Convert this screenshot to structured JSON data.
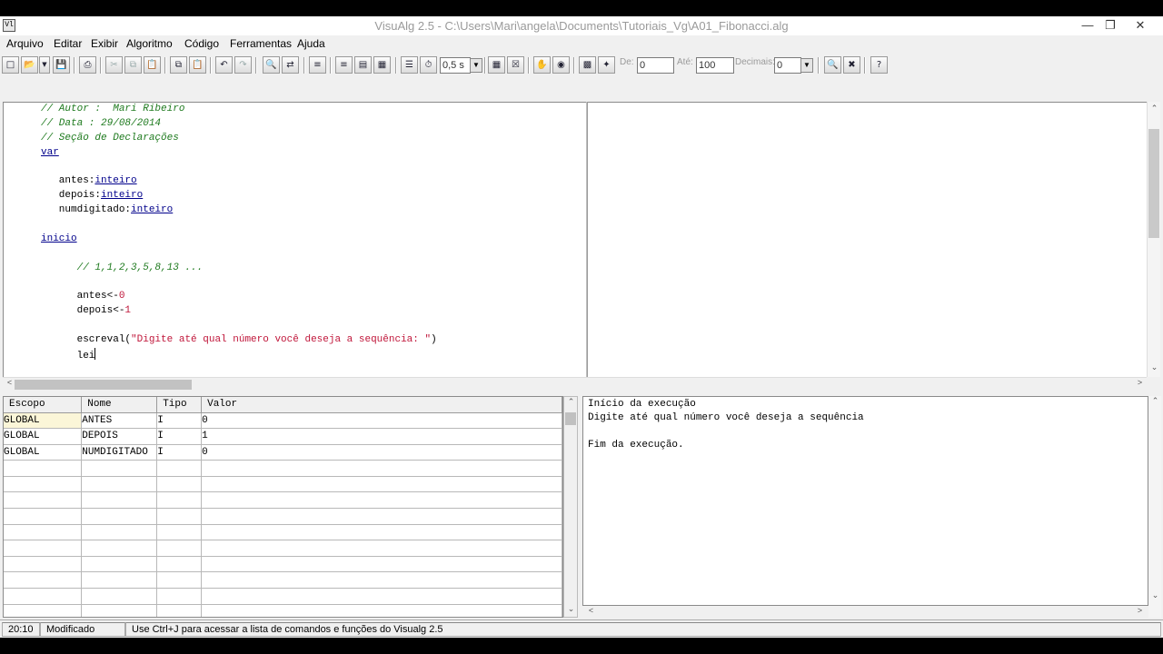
{
  "window": {
    "title": "VisuAlg 2.5 - C:\\Users\\Mari\\angela\\Documents\\Tutoriais_Vg\\A01_Fibonacci.alg",
    "app_icon": "Vl"
  },
  "menu": [
    "Arquivo",
    "Editar",
    "Exibir",
    "Algoritmo",
    "Código",
    "Ferramentas",
    "Ajuda"
  ],
  "toolbar": {
    "speed_value": "0,5 s",
    "de_label": "De:",
    "de_value": "0",
    "ate_label": "Até:",
    "ate_value": "100",
    "decimais_label": "Decimais:",
    "decimais_value": "0"
  },
  "code": [
    {
      "type": "comment",
      "text": "// Autor :  Mari Ribeiro"
    },
    {
      "type": "comment",
      "text": "// Data : 29/08/2014"
    },
    {
      "type": "comment",
      "text": "// Seção de Declarações"
    },
    {
      "type": "kw",
      "text": "var"
    },
    {
      "type": "decl",
      "name": "   antes:",
      "kw": "inteiro"
    },
    {
      "type": "decl",
      "name": "   depois:",
      "kw": "inteiro"
    },
    {
      "type": "decl",
      "name": "   numdigitado:",
      "kw": "inteiro"
    },
    {
      "type": "kw",
      "text": "inicio"
    },
    {
      "type": "comment",
      "text": "      // 1,1,2,3,5,8,13 ..."
    },
    {
      "type": "assign",
      "lhs": "      antes<-",
      "num": "0"
    },
    {
      "type": "assign",
      "lhs": "      depois<-",
      "num": "1"
    },
    {
      "type": "call",
      "pre": "      escreval(",
      "str": "\"Digite até qual número você deseja a sequência: \"",
      "post": ")"
    },
    {
      "type": "plain",
      "text": "      lei"
    }
  ],
  "variables": {
    "headers": [
      "Escopo",
      "Nome",
      "Tipo",
      "Valor"
    ],
    "rows": [
      [
        "GLOBAL",
        "ANTES",
        "I",
        "0"
      ],
      [
        "GLOBAL",
        "DEPOIS",
        "I",
        "1"
      ],
      [
        "GLOBAL",
        "NUMDIGITADO",
        "I",
        "0"
      ]
    ]
  },
  "console": [
    "Início da execução",
    "Digite até qual número você deseja a sequência",
    "",
    "Fim da execução."
  ],
  "status": {
    "position": "20:10",
    "state": "Modificado",
    "hint": "Use Ctrl+J para acessar a lista de comandos e funções do Visualg 2.5"
  }
}
